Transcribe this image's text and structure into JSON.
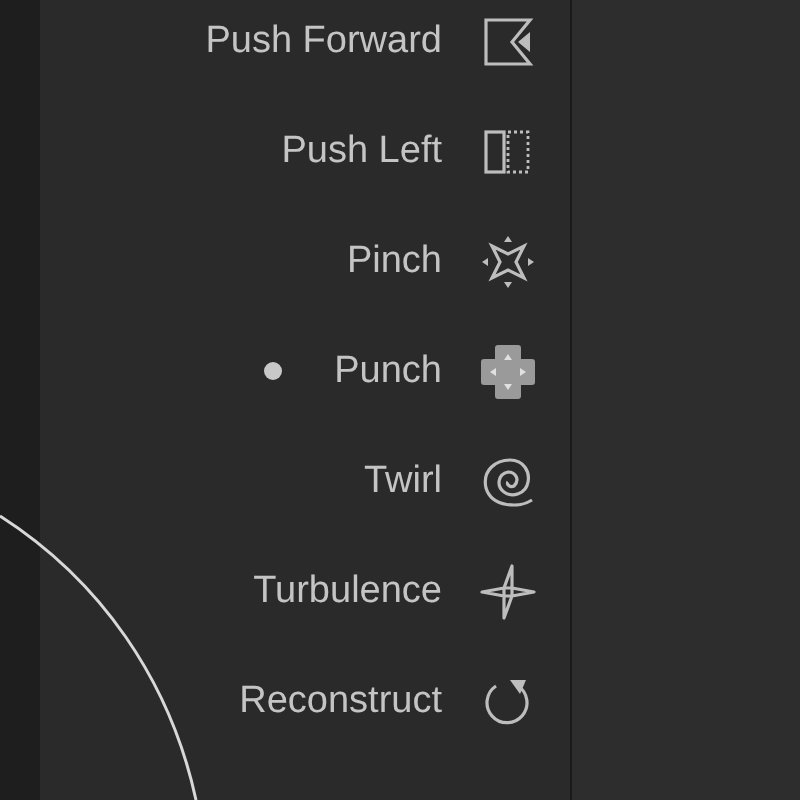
{
  "menu": {
    "items": [
      {
        "label": "Push Forward",
        "kind": "push-forward",
        "selected": false
      },
      {
        "label": "Push Left",
        "kind": "push-left",
        "selected": false
      },
      {
        "label": "Pinch",
        "kind": "pinch",
        "selected": false
      },
      {
        "label": "Punch",
        "kind": "punch",
        "selected": true
      },
      {
        "label": "Twirl",
        "kind": "twirl",
        "selected": false
      },
      {
        "label": "Turbulence",
        "kind": "turbulence",
        "selected": false
      },
      {
        "label": "Reconstruct",
        "kind": "reconstruct",
        "selected": false
      }
    ]
  }
}
